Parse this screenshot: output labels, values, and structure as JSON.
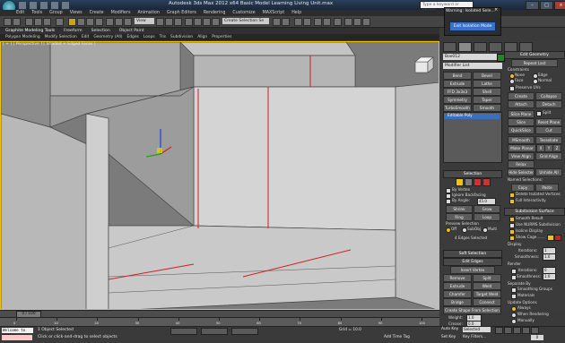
{
  "window": {
    "title": "Autodesk 3ds Max 2012 x64    Basic Model Learning Living Unit.max",
    "search_placeholder": "Type a keyword or phrase",
    "minimize": "–",
    "maximize": "□",
    "close": "×"
  },
  "menu": [
    "Edit",
    "Tools",
    "Group",
    "Views",
    "Create",
    "Modifiers",
    "Animation",
    "Graph Editors",
    "Rendering",
    "Customize",
    "MAXScript",
    "Help"
  ],
  "toolbar": {
    "view_dropdown": "View",
    "selection_set": "Create Selection Se"
  },
  "ribbon": {
    "tabs": [
      "Graphite Modeling Tools",
      "Freeform",
      "Selection",
      "Object Paint"
    ],
    "subtabs": [
      "Polygon Modeling",
      "Modify Selection",
      "Edit",
      "Geometry (All)",
      "Edges",
      "Loops",
      "Tris",
      "Subdivision",
      "Align",
      "Properties"
    ]
  },
  "viewport": {
    "label": "[ + ] [ Perspective ] [ Shaded + Edged Faces ]"
  },
  "popup": {
    "title": "Warning: Isolated Sele...",
    "button": "Exit Isolation Mode",
    "close": "×"
  },
  "command_panel": {
    "object_name": "Box012",
    "object_color": "#1e8a1e",
    "modifier_list": "Modifier List",
    "modifier_buttons": [
      [
        "Bend",
        "Bevel"
      ],
      [
        "Extrude",
        "Lathe"
      ],
      [
        "FFD 3x3x3",
        "Shell"
      ],
      [
        "Symmetry",
        "Taper"
      ],
      [
        "TurboSmooth",
        "Smooth"
      ]
    ],
    "stack_item": "Editable Poly",
    "selection": {
      "header": "Selection",
      "by_vertex": "By Vertex",
      "ignore_backfacing": "Ignore Backfacing",
      "by_angle": "By Angle:",
      "angle_value": "45.0",
      "shrink": "Shrink",
      "grow": "Grow",
      "ring": "Ring",
      "loop": "Loop",
      "preview_selection": "Preview Selection",
      "off": "Off",
      "subobj": "SubObj",
      "multi": "Multi",
      "status": "4 Edges Selected"
    },
    "soft_selection": "Soft Selection",
    "edit_edges": {
      "header": "Edit Edges",
      "insert_vertex": "Insert Vertex",
      "remove": "Remove",
      "split": "Split",
      "extrude": "Extrude",
      "weld": "Weld",
      "chamfer": "Chamfer",
      "target_weld": "Target Weld",
      "bridge": "Bridge",
      "connect": "Connect",
      "create_shape": "Create Shape From Selection",
      "weight": "Weight:",
      "weight_value": "1.0",
      "crease": "Crease:",
      "crease_value": "0.0"
    },
    "edit_geometry": {
      "header": "Edit Geometry",
      "repeat_last": "Repeat Last",
      "constraints": "Constraints",
      "none": "None",
      "edge": "Edge",
      "face": "Face",
      "normal": "Normal",
      "preserve_uvs": "Preserve UVs",
      "create": "Create",
      "collapse": "Collapse",
      "attach": "Attach",
      "detach": "Detach",
      "slice_plane": "Slice Plane",
      "split": "Split",
      "slice": "Slice",
      "reset_plane": "Reset Plane",
      "quickslice": "QuickSlice",
      "cut": "Cut",
      "msmooth": "MSmooth",
      "tessellate": "Tessellate",
      "make_planar": "Make Planar",
      "x": "X",
      "y": "Y",
      "z": "Z",
      "view_align": "View Align",
      "grid_align": "Grid Align",
      "relax": "Relax",
      "hide_selected": "Hide Selected",
      "unhide_all": "Unhide All",
      "named_selections": "Named Selections:",
      "copy": "Copy",
      "paste": "Paste",
      "delete_isolated": "Delete Isolated Vertices",
      "full_interactivity": "Full Interactivity"
    },
    "subdivision_surface": {
      "header": "Subdivision Surface",
      "smooth_result": "Smooth Result",
      "use_nurms": "Use NURMS Subdivision",
      "isoline_display": "Isoline Display",
      "show_cage": "Show Cage.......",
      "display": "Display",
      "iterations": "Iterations:",
      "iterations_value": "1",
      "smoothness": "Smoothness:",
      "smoothness_value": "1.0",
      "render": "Render",
      "r_iterations_value": "0",
      "r_smoothness_value": "1.0",
      "separate_by": "Separate By",
      "smoothing_groups": "Smoothing Groups",
      "materials": "Materials",
      "update_options": "Update Options",
      "always": "Always",
      "when_rendering": "When Rendering",
      "manually": "Manually"
    }
  },
  "timeline": {
    "slider": "0 / 100",
    "ticks": [
      "0",
      "10",
      "20",
      "30",
      "40",
      "50",
      "60",
      "70",
      "80",
      "90",
      "100"
    ]
  },
  "status": {
    "maxscript": "Welcome to MAXScr",
    "selected_count": "1 Object Selected",
    "prompt": "Click or click-and-drag to select objects",
    "grid": "Grid = 10.0",
    "add_time_tag": "Add Time Tag",
    "auto_key": "Auto Key",
    "selected_dropdown": "Selected",
    "set_key": "Set Key",
    "key_filters": "Key Filters...",
    "frame": "0"
  }
}
